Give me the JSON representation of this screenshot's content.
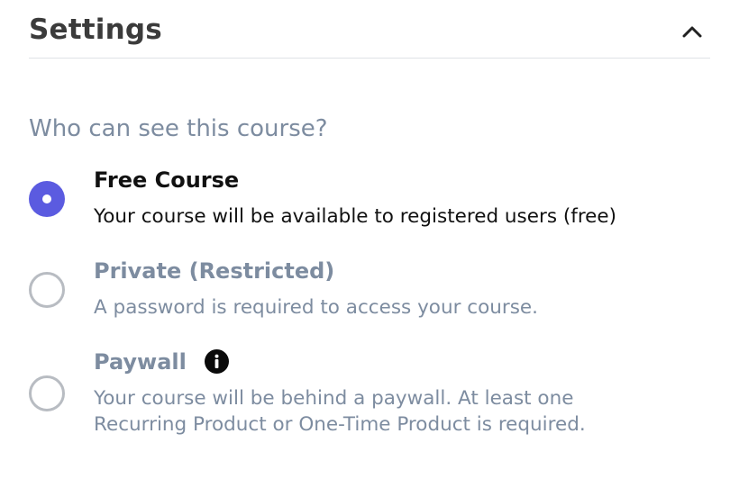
{
  "settings": {
    "title": "Settings",
    "collapse_icon": "chevron-up-icon"
  },
  "visibility": {
    "question": "Who can see this course?",
    "options": [
      {
        "title": "Free Course",
        "description": "Your course will be available to registered users (free)",
        "selected": true
      },
      {
        "title": "Private (Restricted)",
        "description": "A password is required to access your course.",
        "selected": false
      },
      {
        "title": "Paywall",
        "description_line1": "Your course will be behind a paywall. At least one",
        "description_line2": "Recurring Product or One-Time Product is required.",
        "selected": false,
        "info_icon": "info-icon"
      }
    ]
  },
  "colors": {
    "accent": "#5b5be0",
    "muted_text": "#7d8ca0",
    "radio_border": "#b8bcc2"
  }
}
